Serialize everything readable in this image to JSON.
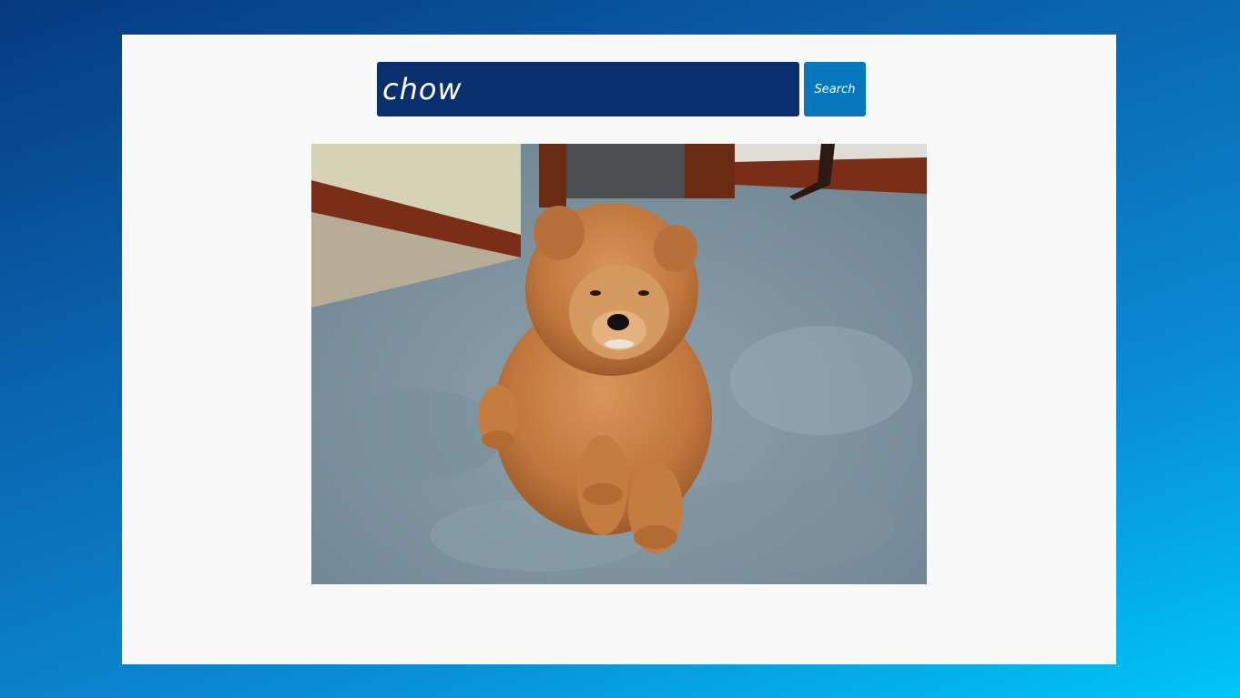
{
  "search": {
    "value": "chow",
    "button_label": "Search"
  },
  "result": {
    "image_subject": "chow-chow-puppy-on-carpet"
  },
  "colors": {
    "input_bg": "#0a2f6e",
    "button_bg": "#0878be",
    "card_bg": "#f9f9f9"
  }
}
